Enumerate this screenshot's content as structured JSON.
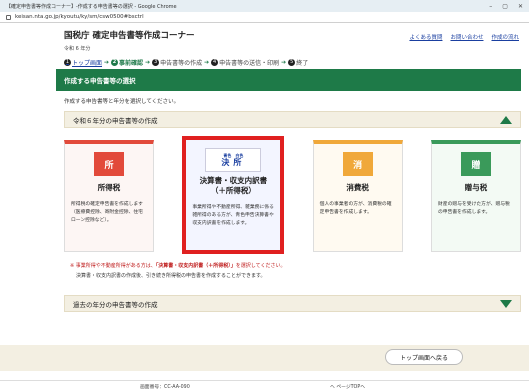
{
  "browser": {
    "window_title": "【確定申告書等作成コーナー】-作成する申告書等の選択 - Google Chrome",
    "url": "keisan.nta.go.jp/kyoutu/ky/sm/csw0500#bsctrl"
  },
  "header": {
    "title": "国税庁 確定申告書等作成コーナー",
    "subtitle": "令和 6 年分",
    "links": [
      "よくある質問",
      "お問い合わせ",
      "作成の流れ"
    ]
  },
  "steps": [
    {
      "num": "1",
      "label": "トップ画面"
    },
    {
      "num": "2",
      "label": "事前確認"
    },
    {
      "num": "3",
      "label": "申告書等の作成"
    },
    {
      "num": "4",
      "label": "申告書等の送信・印刷"
    },
    {
      "num": "5",
      "label": "終了"
    }
  ],
  "main": {
    "section_title": "作成する申告書等の選択",
    "intro": "作成する申告書等と年分を選択してください。",
    "year_section_label": "令和６年分の申告書等の作成",
    "past_section_label": "過去の年分の申告書等の作成",
    "cards": {
      "income": {
        "badge": "所",
        "title": "所得税",
        "desc": "所得税の確定申告書を作成します（医療費控除、寄附金控除、住宅ローン控除など）。"
      },
      "kessan": {
        "badge_top": "青色　白色",
        "badge": "決所",
        "title": "決算書・収支内訳書（＋所得税）",
        "desc": "事業所得や不動産所得、雑業務に係る雑所得のある方が、青色申告決算書や収支内訳書を作成します。"
      },
      "consumption": {
        "badge": "消",
        "title": "消費税",
        "desc": "個人の事業者の方が、消費税の確定申告書を作成します。"
      },
      "gift": {
        "badge": "贈",
        "title": "贈与税",
        "desc": "財産の贈与を受けた方が、贈与税の申告書を作成します。"
      }
    },
    "note_prefix": "※ 事業所得や不動産所得がある方は、",
    "note_emphasis": "「決算書・収支内訳書（＋所得税）」",
    "note_suffix": "を選択してください。",
    "note2": "決算書・収支内訳書の作成後、引き続き所得税の申告書を作成することができます。",
    "top_button": "トップ画面へ戻る"
  },
  "footer": {
    "screen_number": "画面番号：CC-AA-090",
    "page_top": "へ ページTOPへ"
  },
  "colors": {
    "brand_green": "#1e7a48",
    "income": "#e24a3b",
    "consumption": "#f0a83a",
    "gift": "#3a9a5a",
    "highlight": "#e02020"
  }
}
